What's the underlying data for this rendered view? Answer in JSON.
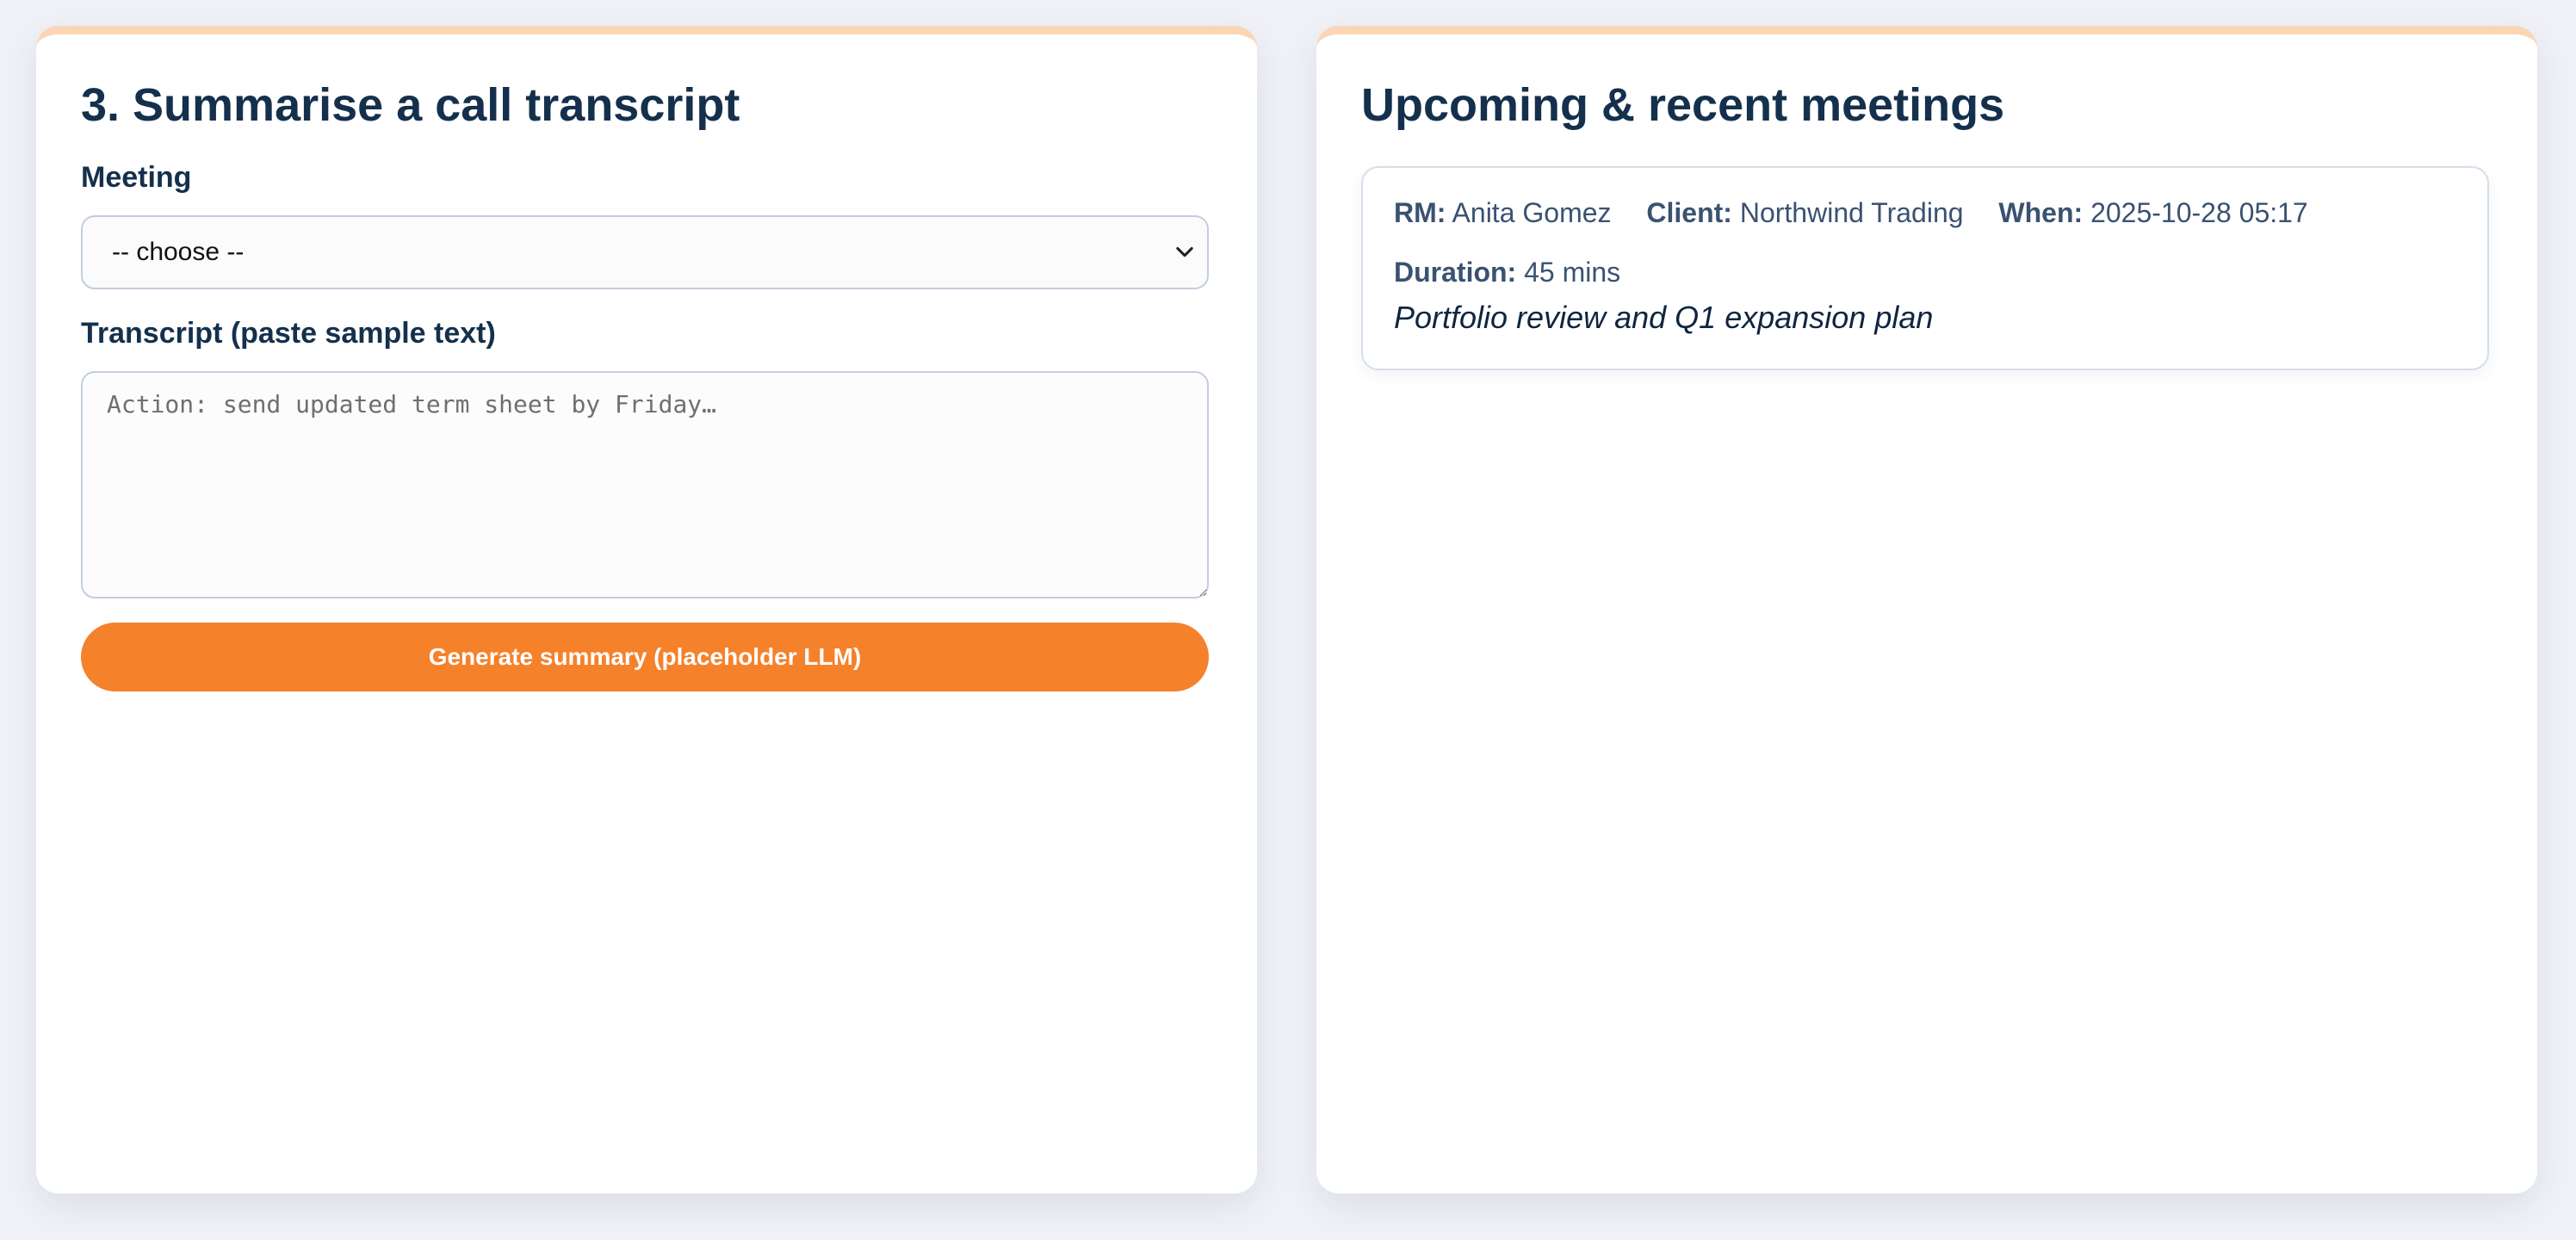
{
  "summarise_panel": {
    "title": "3. Summarise a call transcript",
    "meeting_label": "Meeting",
    "meeting_select": {
      "selected": "-- choose --"
    },
    "transcript_label": "Transcript (paste sample text)",
    "transcript_input": {
      "value": "",
      "placeholder": "Action: send updated term sheet by Friday…"
    },
    "generate_button_label": "Generate summary (placeholder LLM)"
  },
  "meetings_panel": {
    "title": "Upcoming & recent meetings",
    "meetings": [
      {
        "rm_label": "RM:",
        "rm": "Anita Gomez",
        "client_label": "Client:",
        "client": "Northwind Trading",
        "when_label": "When:",
        "when": "2025-10-28 05:17",
        "duration_label": "Duration:",
        "duration": "45 mins",
        "subject": "Portfolio review and Q1 expansion plan"
      }
    ]
  },
  "colors": {
    "accent": "#f5812a",
    "card_top_border": "#fbd6b4",
    "heading": "#14304d",
    "background": "#f0f2f7"
  },
  "icons": {
    "select_chevron": "chevron-down-icon"
  }
}
